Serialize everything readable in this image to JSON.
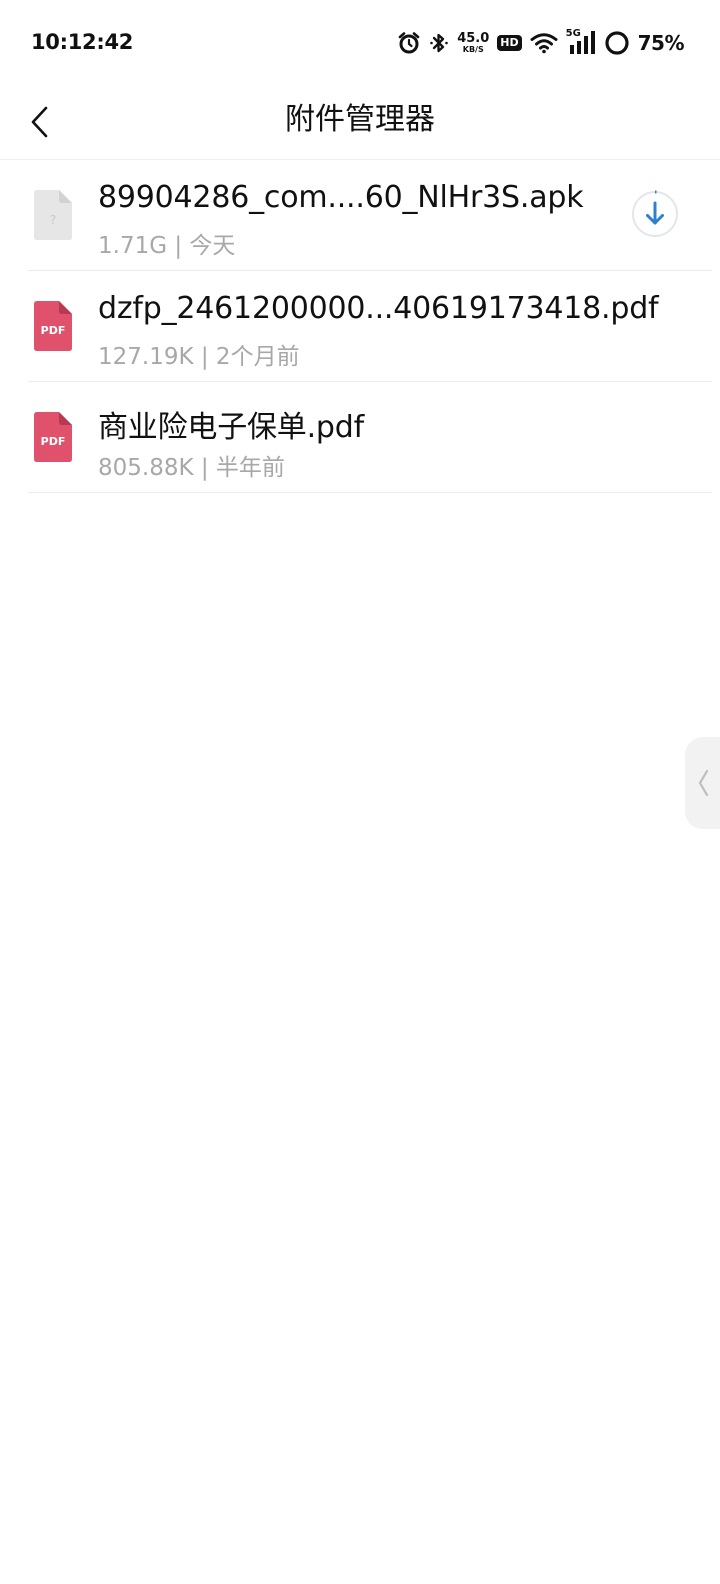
{
  "status_bar": {
    "time": "10:12:42",
    "net_speed_value": "45.0",
    "net_speed_unit": "KB/S",
    "hd_label": "HD",
    "network_label": "5G",
    "battery_percent": "75%",
    "battery_level": 0.75,
    "icons": [
      "alarm-icon",
      "bluetooth-icon",
      "hd-icon",
      "wifi-icon",
      "cellular-signal-icon",
      "battery-ring-icon"
    ]
  },
  "header": {
    "title": "附件管理器",
    "back_icon": "chevron-left-icon"
  },
  "files": [
    {
      "name": "89904286_com....60_NlHr3S.apk",
      "meta": "1.71G | 今天",
      "type": "unknown",
      "icon": "unknown-file-icon",
      "has_download": true,
      "download_icon": "download-arrow-icon"
    },
    {
      "name": "dzfp_2461200000...40619173418.pdf",
      "meta": "127.19K | 2个月前",
      "type": "pdf",
      "icon_label": "PDF",
      "icon": "pdf-file-icon",
      "has_download": false
    },
    {
      "name": "商业险电子保单.pdf",
      "meta": "805.88K | 半年前",
      "type": "pdf",
      "icon_label": "PDF",
      "icon": "pdf-file-icon",
      "has_download": false
    }
  ],
  "side_handle": {
    "icon": "chevron-left-icon"
  },
  "colors": {
    "pdf_red": "#e0526b",
    "unknown_gray": "#e6e6e6",
    "download_blue": "#2f7fd1",
    "meta_gray": "#a8a8a8"
  }
}
